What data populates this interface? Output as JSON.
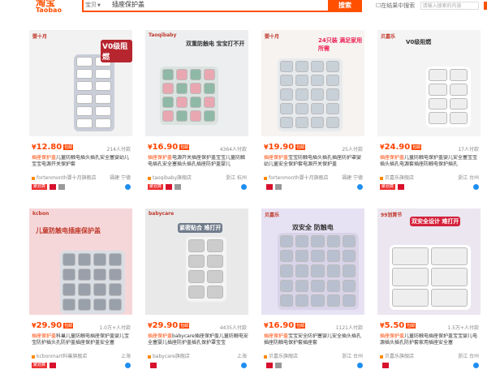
{
  "header": {
    "logo": "淘宝",
    "logo_en": "Taobao",
    "scope": "宝贝",
    "query": "插座保护盖",
    "search_btn": "搜索",
    "in_results": "在结果中搜索",
    "in_results_placeholder": "请输入搜索的内容",
    "confirm": "确定"
  },
  "products": [
    {
      "price": "12.80",
      "sold": "214人付款",
      "title_a": "插座保护盖",
      "title_b": "儿童防触电插头插孔安全塞婴幼儿宝宝电源开关保护套",
      "shop": "fortenmonth婴十月旗舰店",
      "loc": "福建 宁德",
      "badges": [
        "聚划算",
        "天猫",
        "广告"
      ],
      "img_text": "V0级阻燃",
      "img_brand": "婴十月"
    },
    {
      "price": "16.90",
      "sold": "4364人付款",
      "title_a": "插座保护盖",
      "title_b": "电源开关插座保护盖宝宝儿童防触电插孔安全塞插头插孔插座防护盖婴儿",
      "shop": "taoqibaby旗舰店",
      "loc": "浙江 杭州",
      "badges": [
        "聚划算",
        "天猫",
        "广告"
      ],
      "img_text": "双重防触电 宝宝打不开",
      "img_brand": "Taoqibaby"
    },
    {
      "price": "19.90",
      "sold": "25人付款",
      "title_a": "插座保护盖",
      "title_b": "宝宝防触电插头插孔插座防护罩婴幼儿童安全保护套电源开关保护盖",
      "shop": "fortenmonth婴十月旗舰店",
      "loc": "福建 宁德",
      "badges": [
        "天猫",
        "广告"
      ],
      "img_text": "24只装 满足家用所需",
      "img_brand": "婴十月"
    },
    {
      "price": "24.90",
      "sold": "17人付款",
      "title_a": "插座保护盖",
      "title_b": "儿童防触电保护盖婴儿安全塞宝宝插头插孔电源套插座防触电保护插孔",
      "shop": "贝嘉乐旗舰店",
      "loc": "浙江 台州",
      "badges": [
        "聚划算",
        "天猫"
      ],
      "img_text": "V0级阻燃",
      "img_brand": "贝嘉乐"
    },
    {
      "price": "29.90",
      "sold": "1.0万+人付款",
      "title_a": "插座保护盖",
      "title_b": "科巢儿童防触电插座保护盖婴儿宝宝防护插头孔防护盖插座保护盖安全塞",
      "shop": "kcbonmart科巢旗舰店",
      "loc": "上海",
      "badges": [
        "聚划算",
        "天猫"
      ],
      "img_text": "儿童防触电插座保护盖",
      "img_brand": "kcbon"
    },
    {
      "price": "29.90",
      "sold": "4435人付款",
      "title_a": "插座保护盖",
      "title_b": "babycare插座保护盖儿童防触电安全塞婴儿插座防护盖插孔保护罩宝宝",
      "shop": "babycare旗舰店",
      "loc": "上海",
      "badges": [
        "天猫"
      ],
      "img_text": "紧密贴合 难打开",
      "img_brand": "babycare"
    },
    {
      "price": "16.90",
      "sold": "1121人付款",
      "title_a": "插座保护盖",
      "title_b": "宝宝安全防护塞婴儿安全插头插孔插座防触电保护套插座套",
      "shop": "贝嘉乐旗舰店",
      "loc": "浙江 台州",
      "badges": [
        "天猫",
        "广告"
      ],
      "img_text": "双安全 防触电",
      "img_brand": "贝嘉乐"
    },
    {
      "price": "5.50",
      "sold": "1.5万+人付款",
      "title_a": "插座保护盖",
      "title_b": "儿童防触电插座保护盖宝宝婴儿电源插头插孔防护套家用插座安全塞",
      "shop": "贝嘉乐旗舰店",
      "loc": "浙江 台州",
      "badges": [
        "天猫"
      ],
      "img_text": "双安全设计 难打开",
      "img_brand": "99划算节"
    }
  ]
}
